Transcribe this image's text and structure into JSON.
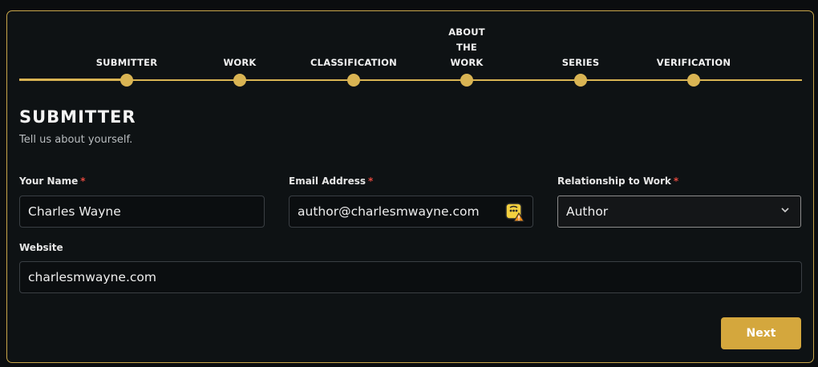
{
  "stepper": {
    "steps": [
      {
        "label": "SUBMITTER"
      },
      {
        "label": "WORK"
      },
      {
        "label": "CLASSIFICATION"
      },
      {
        "label": "ABOUT\nTHE\nWORK"
      },
      {
        "label": "SERIES"
      },
      {
        "label": "VERIFICATION"
      }
    ],
    "active_index": 0
  },
  "section": {
    "title": "SUBMITTER",
    "subtitle": "Tell us about yourself."
  },
  "fields": {
    "name": {
      "label": "Your Name",
      "required_mark": "*",
      "value": "Charles Wayne"
    },
    "email": {
      "label": "Email Address",
      "required_mark": "*",
      "value": "author@charlesmwayne.com",
      "icon": "password-manager-warning-icon"
    },
    "relationship": {
      "label": "Relationship to Work",
      "required_mark": "*",
      "value": "Author"
    },
    "website": {
      "label": "Website",
      "value": "charlesmwayne.com"
    }
  },
  "actions": {
    "next_label": "Next"
  },
  "colors": {
    "accent": "#d9b453",
    "button": "#d4a73d",
    "required": "#e0483e",
    "background": "#0e1214"
  }
}
